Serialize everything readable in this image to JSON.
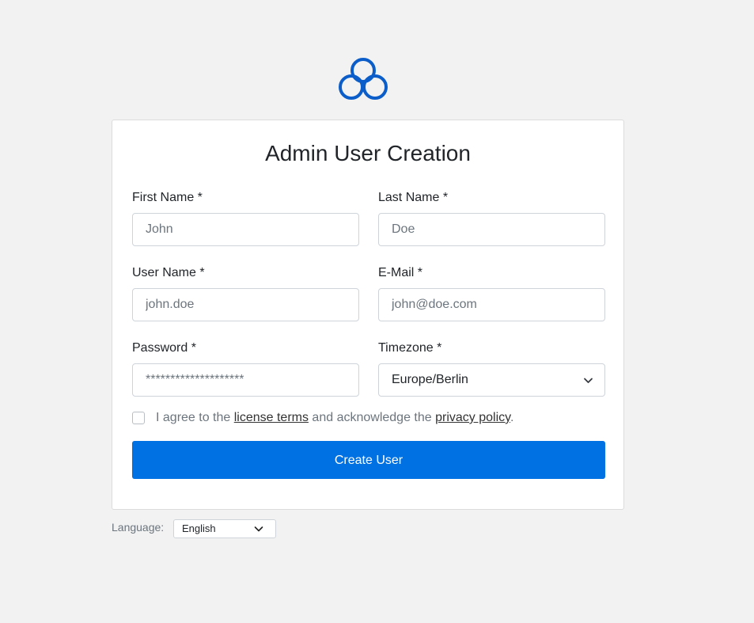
{
  "logo": {
    "icon": "cloud-logo-icon",
    "color": "#0b5ec9"
  },
  "form": {
    "title": "Admin User Creation",
    "first_name": {
      "label": "First Name *",
      "placeholder": "John",
      "value": ""
    },
    "last_name": {
      "label": "Last Name *",
      "placeholder": "Doe",
      "value": ""
    },
    "user_name": {
      "label": "User Name *",
      "placeholder": "john.doe",
      "value": ""
    },
    "email": {
      "label": "E-Mail *",
      "placeholder": "john@doe.com",
      "value": ""
    },
    "password": {
      "label": "Password *",
      "placeholder": "********************",
      "value": ""
    },
    "timezone": {
      "label": "Timezone *",
      "selected": "Europe/Berlin"
    },
    "agree": {
      "checked": false,
      "text_before": "I agree to the ",
      "license_link": "license terms",
      "text_middle": " and acknowledge the ",
      "privacy_link": "privacy policy",
      "text_after": "."
    },
    "submit_label": "Create User"
  },
  "language": {
    "label": "Language:",
    "selected": "English"
  },
  "colors": {
    "accent": "#0071e3",
    "background": "#f2f2f2",
    "logo": "#0b5ec9"
  }
}
